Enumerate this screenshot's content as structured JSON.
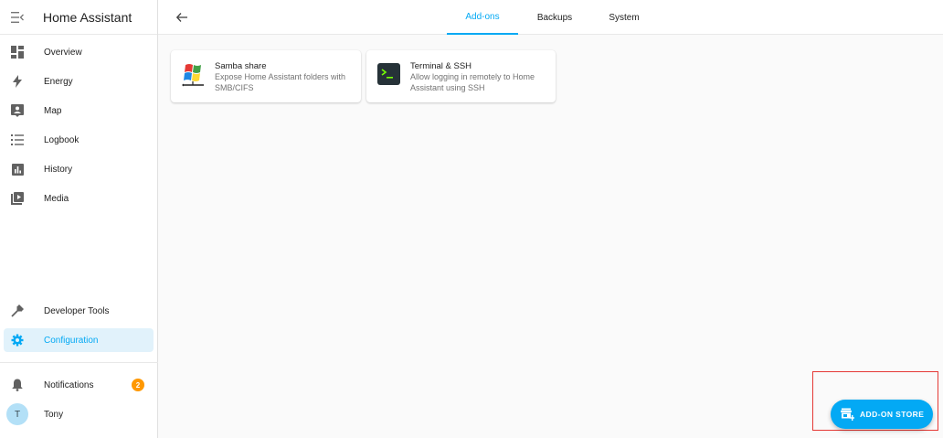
{
  "app": {
    "title": "Home Assistant"
  },
  "sidebar": {
    "items": [
      {
        "label": "Overview",
        "icon": "overview-icon"
      },
      {
        "label": "Energy",
        "icon": "energy-icon"
      },
      {
        "label": "Map",
        "icon": "map-icon"
      },
      {
        "label": "Logbook",
        "icon": "logbook-icon"
      },
      {
        "label": "History",
        "icon": "history-icon"
      },
      {
        "label": "Media",
        "icon": "media-icon"
      }
    ],
    "bottom_items": [
      {
        "label": "Developer Tools",
        "icon": "hammer-icon"
      },
      {
        "label": "Configuration",
        "icon": "gear-icon",
        "active": true
      }
    ],
    "notifications": {
      "label": "Notifications",
      "count": "2"
    },
    "user": {
      "name": "Tony",
      "initial": "T"
    }
  },
  "tabs": [
    {
      "label": "Add-ons",
      "active": true
    },
    {
      "label": "Backups",
      "active": false
    },
    {
      "label": "System",
      "active": false
    }
  ],
  "addons": [
    {
      "title": "Samba share",
      "description": "Expose Home Assistant folders with SMB/CIFS"
    },
    {
      "title": "Terminal & SSH",
      "description": "Allow logging in remotely to Home Assistant using SSH"
    }
  ],
  "fab": {
    "label": "ADD-ON STORE"
  },
  "colors": {
    "accent": "#03a9f4",
    "active_bg": "#e1f2fb",
    "badge": "#ff9800",
    "highlight": "#e53935"
  }
}
